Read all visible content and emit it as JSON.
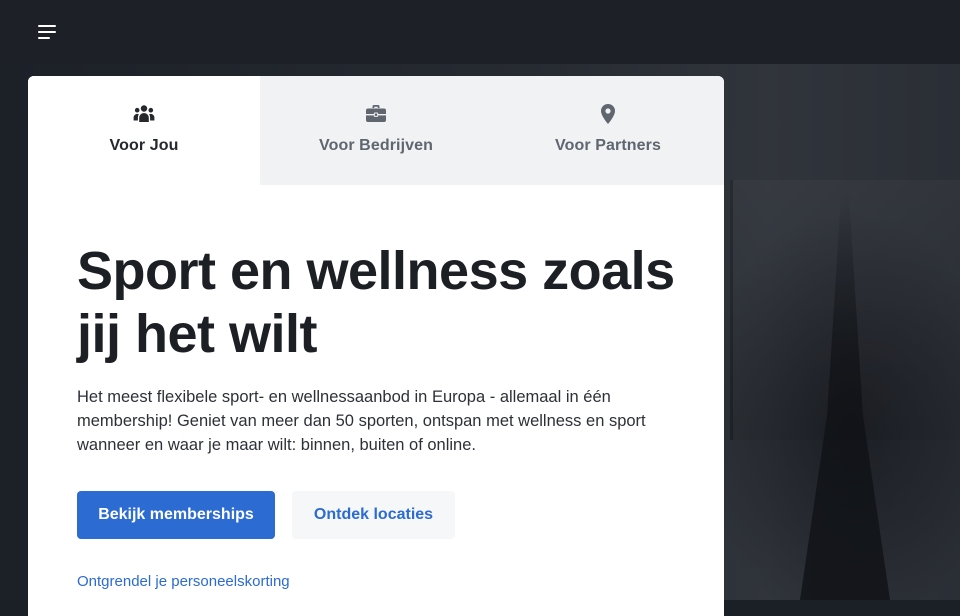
{
  "header": {
    "menu_icon": "hamburger-menu-icon"
  },
  "tabs": [
    {
      "label": "Voor Jou",
      "icon": "people-group-icon",
      "active": true
    },
    {
      "label": "Voor Bedrijven",
      "icon": "briefcase-icon",
      "active": false
    },
    {
      "label": "Voor Partners",
      "icon": "map-pin-icon",
      "active": false
    }
  ],
  "hero": {
    "title": "Sport en wellness zoals jij het wilt",
    "description": "Het meest flexibele sport- en wellnessaanbod in Europa - allemaal in één membership! Geniet van meer dan 50 sporten, ontspan met wellness en sport wanneer en waar je maar wilt: binnen, buiten of online.",
    "primary_button": "Bekijk memberships",
    "secondary_button": "Ontdek locaties",
    "link": "Ontgrendel je personeelskorting"
  },
  "colors": {
    "accent": "#2c6bd1",
    "topbar": "#1d2027",
    "tab_inactive_bg": "#f1f2f4"
  }
}
